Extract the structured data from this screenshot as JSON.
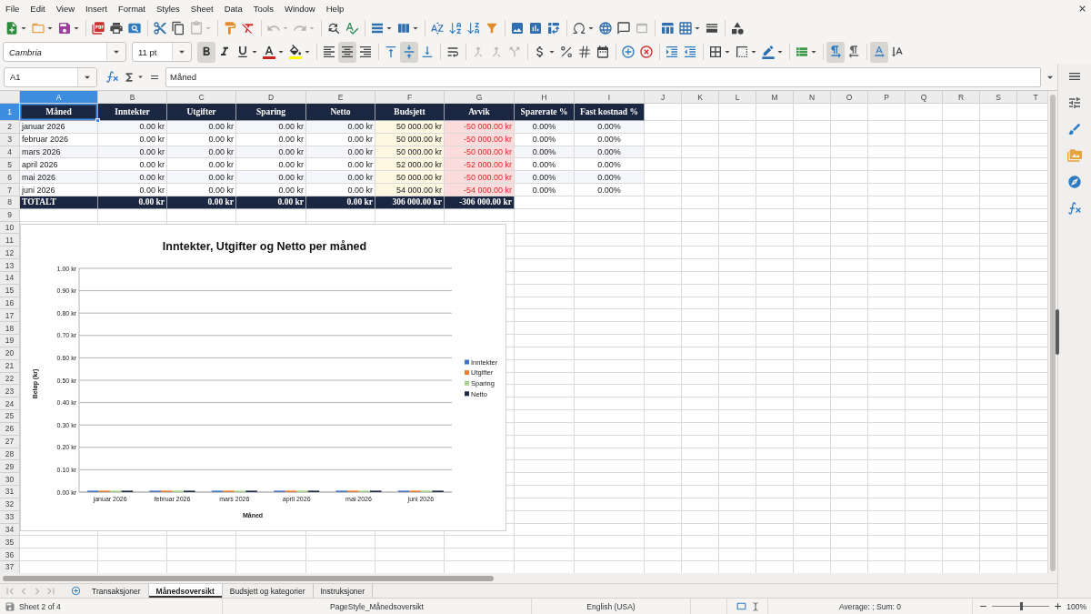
{
  "menu": [
    "File",
    "Edit",
    "View",
    "Insert",
    "Format",
    "Styles",
    "Sheet",
    "Data",
    "Tools",
    "Window",
    "Help"
  ],
  "standard_toolbar": {
    "groups": [
      [
        {
          "kind": "new",
          "dropdown": true,
          "disabled": false
        },
        {
          "kind": "open",
          "dropdown": true,
          "disabled": false
        },
        {
          "kind": "save",
          "dropdown": true,
          "disabled": false
        }
      ],
      [
        {
          "kind": "pdf",
          "dropdown": false,
          "disabled": false
        },
        {
          "kind": "print",
          "dropdown": false,
          "disabled": false
        },
        {
          "kind": "preview",
          "dropdown": false,
          "disabled": false
        }
      ],
      [
        {
          "kind": "cut",
          "dropdown": false,
          "disabled": false
        },
        {
          "kind": "copy",
          "dropdown": false,
          "disabled": false
        },
        {
          "kind": "paste",
          "dropdown": true,
          "disabled": true
        }
      ],
      [
        {
          "kind": "clone",
          "dropdown": false,
          "disabled": false
        },
        {
          "kind": "clear",
          "dropdown": false,
          "disabled": false
        }
      ],
      [
        {
          "kind": "undo",
          "dropdown": true,
          "disabled": true
        },
        {
          "kind": "redo",
          "dropdown": true,
          "disabled": true
        }
      ],
      [
        {
          "kind": "find",
          "dropdown": false,
          "disabled": false
        },
        {
          "kind": "spelling",
          "dropdown": false,
          "disabled": false
        }
      ],
      [
        {
          "kind": "rows",
          "dropdown": true,
          "disabled": false
        },
        {
          "kind": "columns",
          "dropdown": true,
          "disabled": false
        }
      ],
      [
        {
          "kind": "sort",
          "dropdown": false,
          "disabled": false
        },
        {
          "kind": "ascending",
          "dropdown": false,
          "disabled": false
        },
        {
          "kind": "descending",
          "dropdown": false,
          "disabled": false
        },
        {
          "kind": "autofilter",
          "dropdown": false,
          "disabled": false
        }
      ],
      [
        {
          "kind": "image",
          "dropdown": false,
          "disabled": false
        },
        {
          "kind": "chart",
          "dropdown": false,
          "disabled": false
        },
        {
          "kind": "pivot",
          "dropdown": false,
          "disabled": false
        }
      ],
      [
        {
          "kind": "symbol",
          "dropdown": true,
          "disabled": false
        },
        {
          "kind": "hyperlink",
          "dropdown": false,
          "disabled": false
        },
        {
          "kind": "comment",
          "dropdown": false,
          "disabled": false
        },
        {
          "kind": "headerfooter",
          "dropdown": false,
          "disabled": true
        }
      ],
      [
        {
          "kind": "printarea",
          "dropdown": false,
          "disabled": false
        },
        {
          "kind": "freeze",
          "dropdown": true,
          "disabled": false
        },
        {
          "kind": "split",
          "dropdown": false,
          "disabled": false
        }
      ],
      [
        {
          "kind": "shapes",
          "dropdown": false,
          "disabled": false
        }
      ]
    ]
  },
  "formatting_toolbar": {
    "font_name": "Cambria",
    "font_size": "11 pt",
    "groups": [
      [
        {
          "kind": "bold",
          "on": true,
          "dropdown": false,
          "disabled": false
        },
        {
          "kind": "italic",
          "on": false,
          "dropdown": false,
          "disabled": false
        },
        {
          "kind": "underline",
          "on": false,
          "dropdown": true,
          "disabled": false
        },
        {
          "kind": "fontcolor",
          "on": false,
          "dropdown": true,
          "disabled": false
        },
        {
          "kind": "highlight",
          "on": false,
          "dropdown": true,
          "disabled": false
        }
      ],
      [
        {
          "kind": "left",
          "on": false,
          "dropdown": false,
          "disabled": false
        },
        {
          "kind": "center",
          "on": true,
          "dropdown": false,
          "disabled": false
        },
        {
          "kind": "right",
          "on": false,
          "dropdown": false,
          "disabled": false
        }
      ],
      [
        {
          "kind": "top",
          "on": false,
          "dropdown": false,
          "disabled": false
        },
        {
          "kind": "middle",
          "on": true,
          "dropdown": false,
          "disabled": false
        },
        {
          "kind": "bottom",
          "on": false,
          "dropdown": false,
          "disabled": false
        }
      ],
      [
        {
          "kind": "wrap",
          "on": false,
          "dropdown": false,
          "disabled": false
        }
      ],
      [
        {
          "kind": "mergecenter",
          "on": false,
          "dropdown": false,
          "disabled": true
        },
        {
          "kind": "merge",
          "on": false,
          "dropdown": false,
          "disabled": true
        },
        {
          "kind": "unmerge",
          "on": false,
          "dropdown": false,
          "disabled": true
        }
      ],
      [
        {
          "kind": "currency",
          "on": false,
          "dropdown": true,
          "disabled": false
        },
        {
          "kind": "percent",
          "on": false,
          "dropdown": false,
          "disabled": false
        },
        {
          "kind": "number",
          "on": false,
          "dropdown": false,
          "disabled": false
        },
        {
          "kind": "date",
          "on": false,
          "dropdown": false,
          "disabled": false
        }
      ],
      [
        {
          "kind": "adddecimal",
          "on": false,
          "dropdown": false,
          "disabled": false
        },
        {
          "kind": "deldecimal",
          "on": false,
          "dropdown": false,
          "disabled": false
        }
      ],
      [
        {
          "kind": "indent",
          "on": false,
          "dropdown": false,
          "disabled": false
        },
        {
          "kind": "outdent",
          "on": false,
          "dropdown": false,
          "disabled": false
        }
      ],
      [
        {
          "kind": "borders",
          "on": false,
          "dropdown": true,
          "disabled": false
        },
        {
          "kind": "borderstyle",
          "on": false,
          "dropdown": true,
          "disabled": false
        },
        {
          "kind": "bordercolor",
          "on": false,
          "dropdown": true,
          "disabled": false
        }
      ],
      [
        {
          "kind": "conditional",
          "on": false,
          "dropdown": true,
          "disabled": false
        }
      ],
      [
        {
          "kind": "ltr",
          "on": true,
          "dropdown": false,
          "disabled": false
        },
        {
          "kind": "rtl",
          "on": false,
          "dropdown": false,
          "disabled": false
        }
      ],
      [
        {
          "kind": "horizontal",
          "on": true,
          "dropdown": false,
          "disabled": false
        },
        {
          "kind": "vertical",
          "on": false,
          "dropdown": false,
          "disabled": false
        }
      ]
    ]
  },
  "formula_bar": {
    "cell_reference": "A1",
    "content": "Måned"
  },
  "sheet": {
    "column_headers": [
      {
        "label": "A",
        "selected": true
      },
      {
        "label": "B",
        "selected": false
      },
      {
        "label": "C",
        "selected": false
      },
      {
        "label": "D",
        "selected": false
      },
      {
        "label": "E",
        "selected": false
      },
      {
        "label": "F",
        "selected": false
      },
      {
        "label": "G",
        "selected": false
      },
      {
        "label": "H",
        "selected": false
      },
      {
        "label": "I",
        "selected": false
      },
      {
        "label": "J",
        "selected": false
      },
      {
        "label": "K",
        "selected": false
      },
      {
        "label": "L",
        "selected": false
      },
      {
        "label": "M",
        "selected": false
      },
      {
        "label": "N",
        "selected": false
      },
      {
        "label": "O",
        "selected": false
      },
      {
        "label": "P",
        "selected": false
      },
      {
        "label": "Q",
        "selected": false
      },
      {
        "label": "R",
        "selected": false
      },
      {
        "label": "S",
        "selected": false
      },
      {
        "label": "T",
        "selected": false
      }
    ],
    "row_headers": [
      {
        "label": "1",
        "selected": true
      },
      {
        "label": "2",
        "selected": false
      },
      {
        "label": "3",
        "selected": false
      },
      {
        "label": "4",
        "selected": false
      },
      {
        "label": "5",
        "selected": false
      },
      {
        "label": "6",
        "selected": false
      },
      {
        "label": "7",
        "selected": false
      },
      {
        "label": "8",
        "selected": false
      },
      {
        "label": "9",
        "selected": false
      },
      {
        "label": "10",
        "selected": false
      },
      {
        "label": "11",
        "selected": false
      },
      {
        "label": "12",
        "selected": false
      },
      {
        "label": "13",
        "selected": false
      },
      {
        "label": "14",
        "selected": false
      },
      {
        "label": "15",
        "selected": false
      },
      {
        "label": "16",
        "selected": false
      },
      {
        "label": "17",
        "selected": false
      },
      {
        "label": "18",
        "selected": false
      },
      {
        "label": "19",
        "selected": false
      },
      {
        "label": "20",
        "selected": false
      },
      {
        "label": "21",
        "selected": false
      },
      {
        "label": "22",
        "selected": false
      },
      {
        "label": "23",
        "selected": false
      },
      {
        "label": "24",
        "selected": false
      },
      {
        "label": "25",
        "selected": false
      },
      {
        "label": "26",
        "selected": false
      },
      {
        "label": "27",
        "selected": false
      },
      {
        "label": "28",
        "selected": false
      },
      {
        "label": "29",
        "selected": false
      },
      {
        "label": "30",
        "selected": false
      },
      {
        "label": "31",
        "selected": false
      },
      {
        "label": "32",
        "selected": false
      },
      {
        "label": "33",
        "selected": false
      },
      {
        "label": "34",
        "selected": false
      },
      {
        "label": "35",
        "selected": false
      },
      {
        "label": "36",
        "selected": false
      },
      {
        "label": "37",
        "selected": false
      }
    ],
    "table": {
      "columns": [
        {
          "heading": "Måned",
          "kind": "text"
        },
        {
          "heading": "Inntekter",
          "kind": "amount"
        },
        {
          "heading": "Utgifter",
          "kind": "amount"
        },
        {
          "heading": "Sparing",
          "kind": "amount"
        },
        {
          "heading": "Netto",
          "kind": "amount"
        },
        {
          "heading": "Budsjett",
          "kind": "budget"
        },
        {
          "heading": "Avvik",
          "kind": "deviation"
        },
        {
          "heading": "Sparerate %",
          "kind": "percent"
        },
        {
          "heading": "Fast kostnad %",
          "kind": "percent"
        }
      ],
      "rows": [
        [
          "januar 2026",
          "0.00 kr",
          "0.00 kr",
          "0.00 kr",
          "0.00 kr",
          "50 000.00 kr",
          "-50 000.00 kr",
          "0.00%",
          "0.00%"
        ],
        [
          "februar 2026",
          "0.00 kr",
          "0.00 kr",
          "0.00 kr",
          "0.00 kr",
          "50 000.00 kr",
          "-50 000.00 kr",
          "0.00%",
          "0.00%"
        ],
        [
          "mars 2026",
          "0.00 kr",
          "0.00 kr",
          "0.00 kr",
          "0.00 kr",
          "50 000.00 kr",
          "-50 000.00 kr",
          "0.00%",
          "0.00%"
        ],
        [
          "april 2026",
          "0.00 kr",
          "0.00 kr",
          "0.00 kr",
          "0.00 kr",
          "52 000.00 kr",
          "-52 000.00 kr",
          "0.00%",
          "0.00%"
        ],
        [
          "mai 2026",
          "0.00 kr",
          "0.00 kr",
          "0.00 kr",
          "0.00 kr",
          "50 000.00 kr",
          "-50 000.00 kr",
          "0.00%",
          "0.00%"
        ],
        [
          "juni 2026",
          "0.00 kr",
          "0.00 kr",
          "0.00 kr",
          "0.00 kr",
          "54 000.00 kr",
          "-54 000.00 kr",
          "0.00%",
          "0.00%"
        ]
      ],
      "total": [
        "TOTALT",
        "0.00 kr",
        "0.00 kr",
        "0.00 kr",
        "0.00 kr",
        "306 000.00 kr",
        "-306 000.00 kr"
      ]
    },
    "chart": {
      "chart_data": {
        "type": "bar",
        "title": "Inntekter, Utgifter og Netto per måned",
        "xlabel": "Måned",
        "ylabel": "Beløp (kr)",
        "categories": [
          "januar 2026",
          "februar 2026",
          "mars 2026",
          "april 2026",
          "mai 2026",
          "juni 2026"
        ],
        "series": [
          {
            "name": "Inntekter",
            "color": "#4472c4",
            "values": [
              0,
              0,
              0,
              0,
              0,
              0
            ]
          },
          {
            "name": "Utgifter",
            "color": "#ed7d31",
            "values": [
              0,
              0,
              0,
              0,
              0,
              0
            ]
          },
          {
            "name": "Sparing",
            "color": "#a9d18e",
            "values": [
              0,
              0,
              0,
              0,
              0,
              0
            ]
          },
          {
            "name": "Netto",
            "color": "#1f2a44",
            "values": [
              0,
              0,
              0,
              0,
              0,
              0
            ]
          }
        ],
        "ylim": [
          0,
          1
        ],
        "yticks": [
          {
            "value": 0,
            "label": "0.00 kr"
          },
          {
            "value": 0.1,
            "label": "0.10 kr"
          },
          {
            "value": 0.2,
            "label": "0.20 kr"
          },
          {
            "value": 0.3,
            "label": "0.30 kr"
          },
          {
            "value": 0.4,
            "label": "0.40 kr"
          },
          {
            "value": 0.5,
            "label": "0.50 kr"
          },
          {
            "value": 0.6,
            "label": "0.60 kr"
          },
          {
            "value": 0.7,
            "label": "0.70 kr"
          },
          {
            "value": 0.8,
            "label": "0.80 kr"
          },
          {
            "value": 0.9,
            "label": "0.90 kr"
          },
          {
            "value": 1,
            "label": "1.00 kr"
          }
        ],
        "grid": true,
        "legend": "right"
      }
    }
  },
  "sheet_tabs": [
    {
      "label": "Transaksjoner",
      "selected": false
    },
    {
      "label": "Månedsoversikt",
      "selected": true
    },
    {
      "label": "Budsjett og kategorier",
      "selected": false
    },
    {
      "label": "Instruksjoner",
      "selected": false
    }
  ],
  "status_bar": {
    "sheet": "Sheet 2 of 4",
    "page_style": "PageStyle_Månedsoversikt",
    "language": "English (USA)",
    "statistics": "Average: ; Sum: 0",
    "zoom": {
      "level": 0.5,
      "percent": "100%"
    }
  }
}
